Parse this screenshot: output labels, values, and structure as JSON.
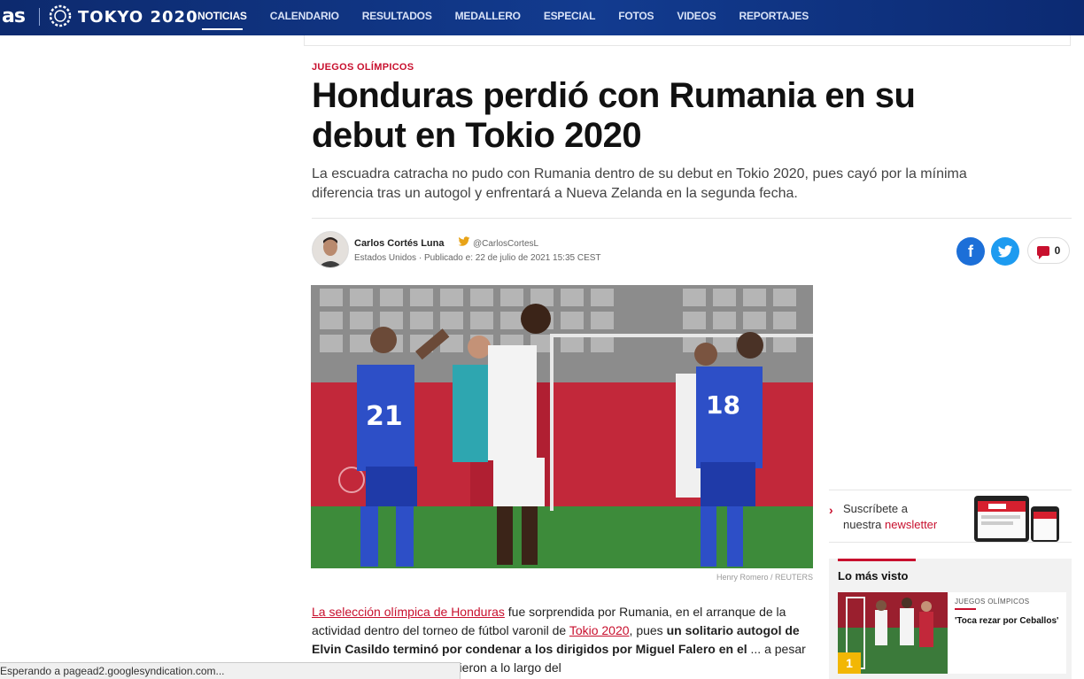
{
  "nav": {
    "logo": "as",
    "brand": "TOKYO 2020",
    "items": [
      {
        "label": "NOTICIAS",
        "active": true
      },
      {
        "label": "CALENDARIO"
      },
      {
        "label": "RESULTADOS"
      },
      {
        "label": "MEDALLERO"
      },
      {
        "label": "ESPECIAL"
      },
      {
        "label": "FOTOS"
      },
      {
        "label": "VIDEOS"
      },
      {
        "label": "REPORTAJES"
      }
    ]
  },
  "article": {
    "kicker": "JUEGOS OLÍMPICOS",
    "headline": "Honduras perdió con Rumania en su debut en Tokio 2020",
    "subhead": "La escuadra catracha no pudo con Rumania dentro de su debut en Tokio 2020, pues cayó por la mínima diferencia tras un autogol y enfrentará a Nueva Zelanda en la segunda fecha.",
    "author": {
      "name": "Carlos Cortés Luna",
      "twitter": "@CarlosCortesL",
      "location": "Estados Unidos",
      "published": "Publicado e: 22 de julio de 2021 15:35 CEST"
    },
    "comments_count": "0",
    "photo_caption": "Henry Romero  /  REUTERS",
    "photo_players": {
      "left": "21",
      "right": "18"
    },
    "body": {
      "link1": "La selección olímpica de Honduras",
      "text1": " fue sorprendida por Rumania, en el arranque de la actividad dentro del torneo de fútbol varonil de ",
      "link2": "Tokio 2020",
      "text2": ", pues ",
      "bold1": "un solitario autogol de Elvin Casildo terminó por condenar a los dirigidos por Miguel Falero en el",
      "text3": " ... a pesar del amplio dominio que tuvieron a lo largo del"
    }
  },
  "statusbar": {
    "text": "Esperando a pagead2.googlesyndication.com..."
  },
  "sidebar": {
    "newsletter": {
      "line1": "Suscríbete a",
      "line2_prefix": "nuestra ",
      "line2_highlight": "newsletter"
    },
    "most_read": {
      "title": "Lo más visto",
      "items": [
        {
          "rank": "1",
          "kicker": "JUEGOS OLÍMPICOS",
          "headline": "'Toca rezar por Ceballos'"
        }
      ]
    }
  },
  "colors": {
    "brand_blue": "#123b8f",
    "accent_red": "#c8102e",
    "facebook": "#1c6fd8",
    "twitter": "#1d9bf0"
  }
}
